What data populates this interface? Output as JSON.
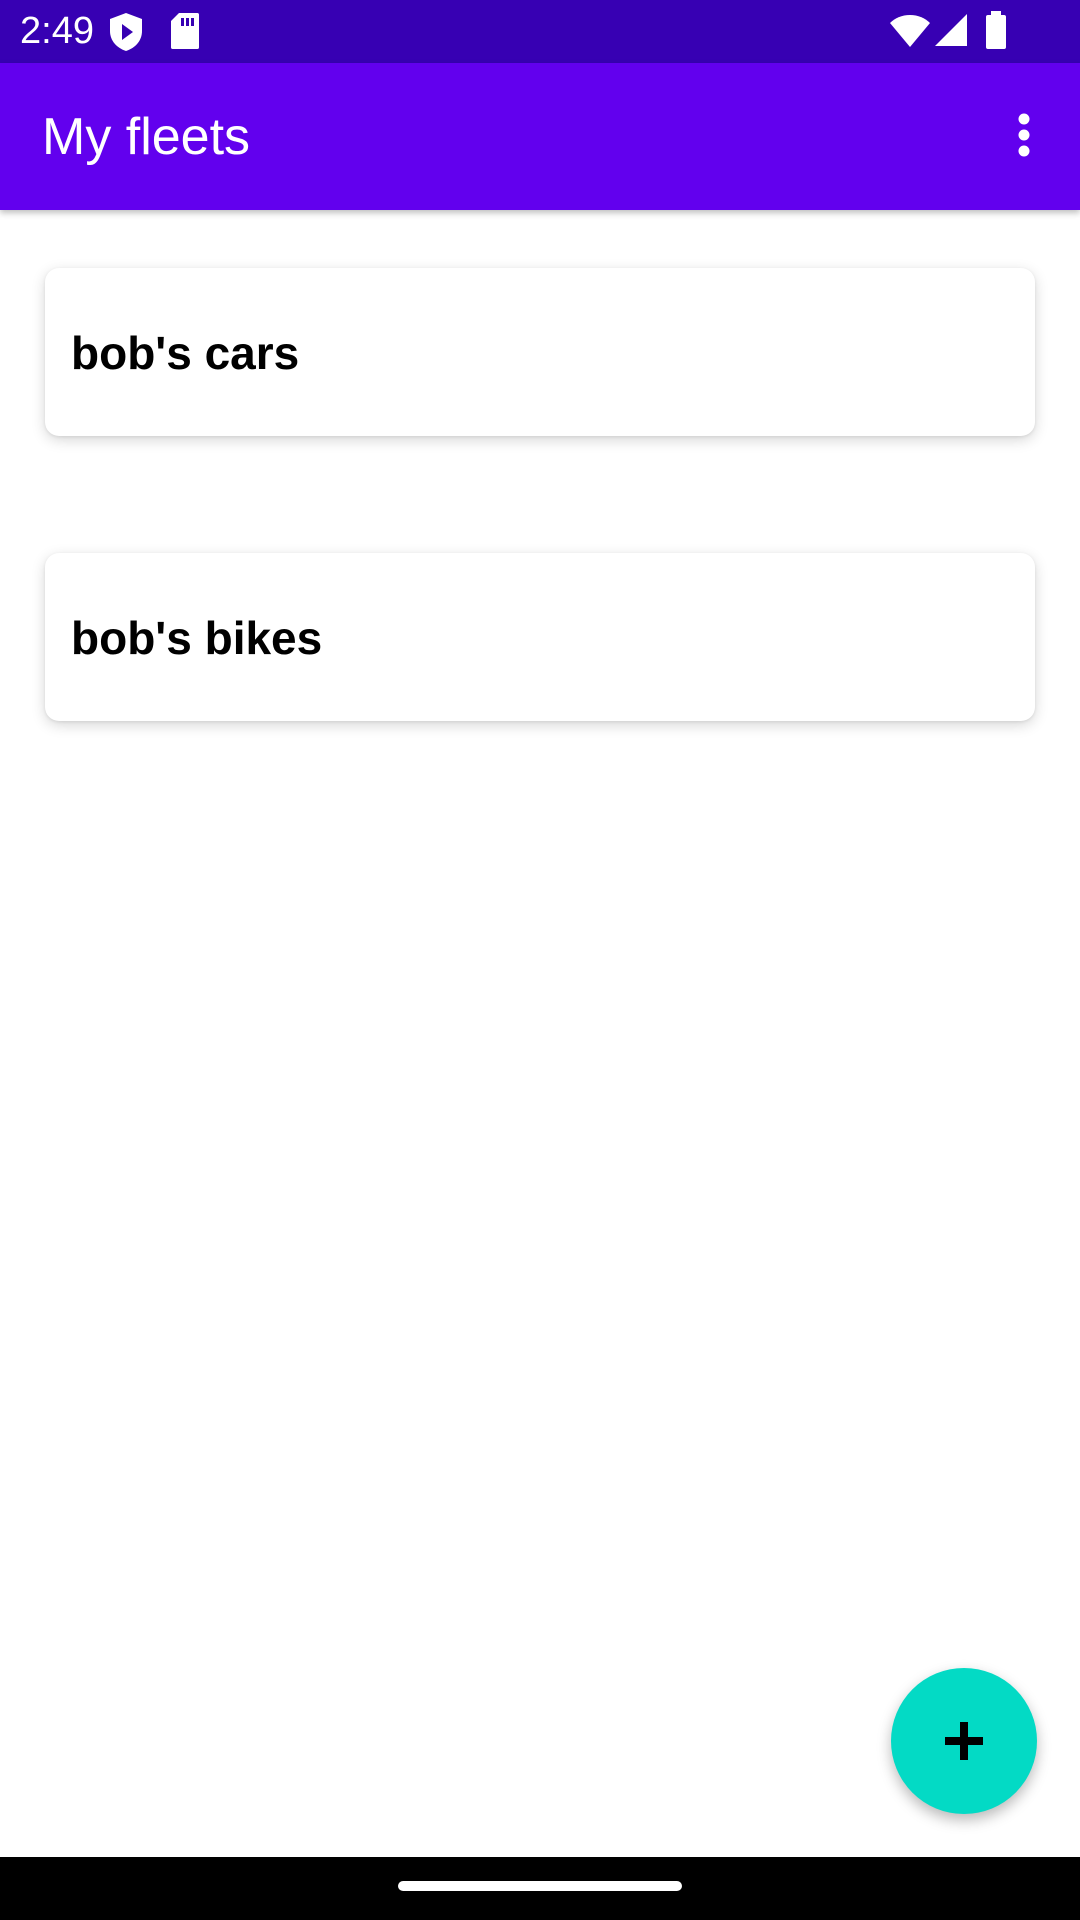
{
  "status_bar": {
    "time": "2:49",
    "left_icons": [
      "shield-play-icon",
      "sd-card-icon"
    ],
    "right_icons": [
      "wifi-icon",
      "cell-signal-icon",
      "battery-icon"
    ]
  },
  "app_bar": {
    "title": "My fleets",
    "overflow_icon": "more-vert-icon"
  },
  "fleets": [
    {
      "name": "bob's cars"
    },
    {
      "name": "bob's bikes"
    }
  ],
  "fab": {
    "icon": "add-icon"
  },
  "colors": {
    "status_bar": "#3700b3",
    "app_bar": "#6200ee",
    "fab": "#03dac5",
    "nav_bar": "#000000"
  }
}
